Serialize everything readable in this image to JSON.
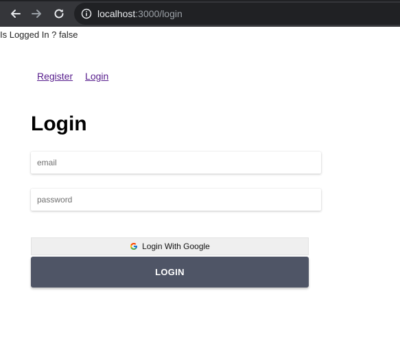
{
  "browser": {
    "url_host": "localhost",
    "url_rest": ":3000/login"
  },
  "status": {
    "text": "Is Logged In ? false"
  },
  "nav": {
    "register_label": "Register",
    "login_label": "Login"
  },
  "page": {
    "title": "Login"
  },
  "form": {
    "email_placeholder": "email",
    "password_placeholder": "password",
    "google_button_label": "Login With Google",
    "login_button_label": "LOGIN"
  },
  "colors": {
    "browser_bar": "#35363a",
    "omnibox": "#202124",
    "login_button": "#4f5566",
    "google_button": "#efefef",
    "link": "#551a8b"
  },
  "icons": {
    "back": "back-arrow-icon",
    "forward": "forward-arrow-icon",
    "reload": "reload-icon",
    "info": "info-icon",
    "google": "google-g-icon"
  }
}
